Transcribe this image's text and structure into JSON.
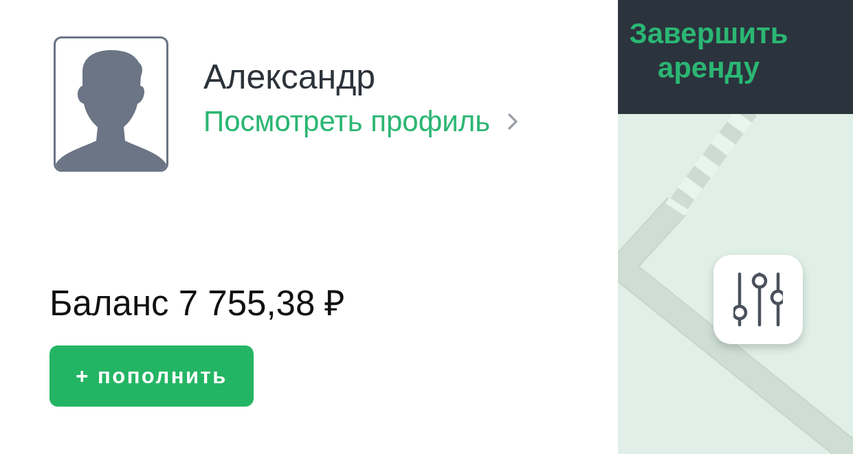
{
  "profile": {
    "name": "Александр",
    "link": "Посмотреть профиль"
  },
  "balance": {
    "text": "Баланс 7 755,38 ₽"
  },
  "top_up_button": {
    "label": "+ пополнить"
  },
  "map_panel": {
    "end_rental_button": {
      "label": "Завершить аренду"
    }
  }
}
